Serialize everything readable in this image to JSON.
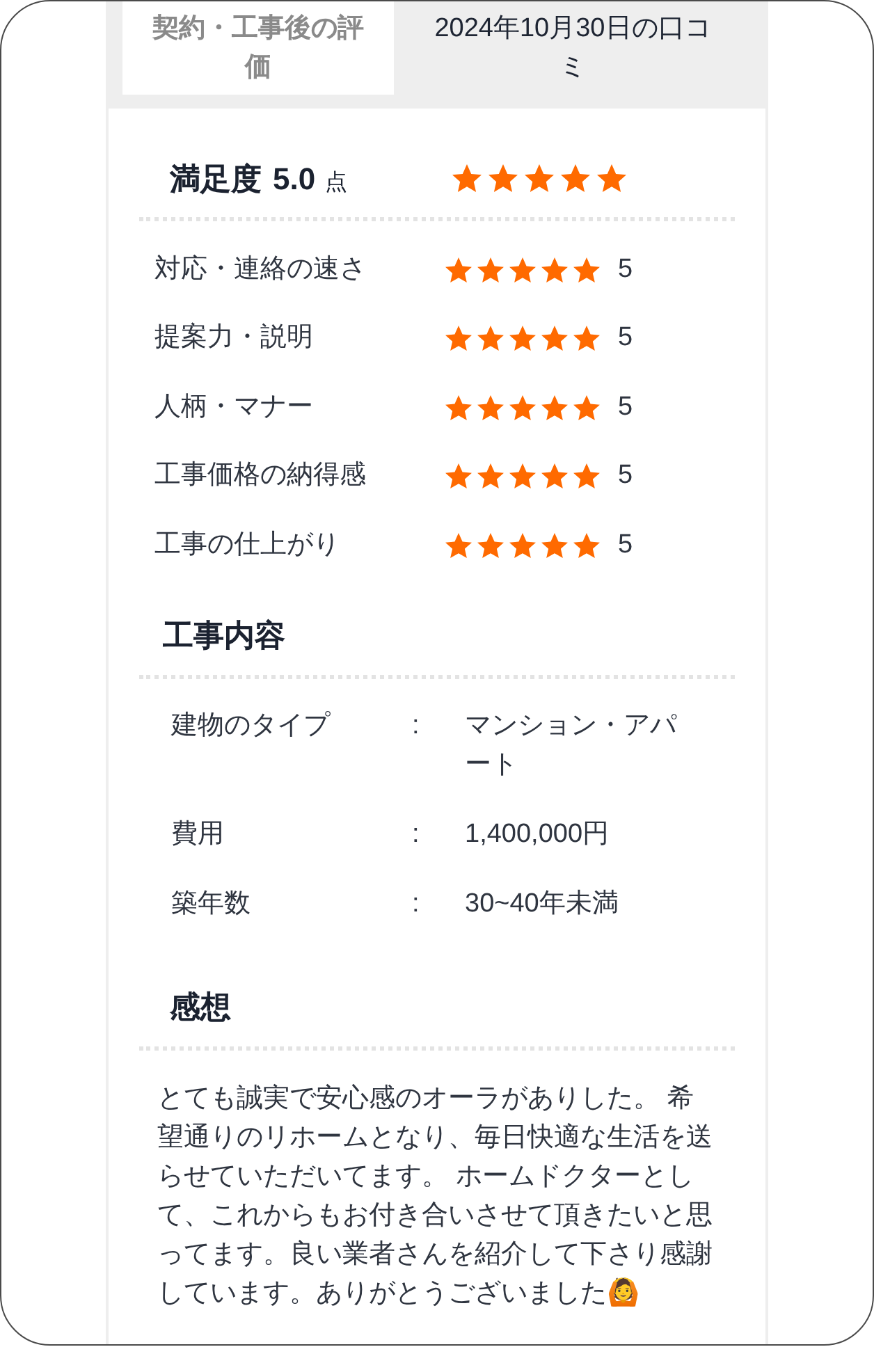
{
  "header": {
    "label": "契約・工事後の評価",
    "title": "2024年10月30日の口コミ"
  },
  "satisfaction": {
    "label": "満足度",
    "score": "5.0",
    "unit": "点",
    "stars": 5
  },
  "ratings": [
    {
      "label": "対応・連絡の速さ",
      "stars": 5,
      "score": "5"
    },
    {
      "label": "提案力・説明",
      "stars": 5,
      "score": "5"
    },
    {
      "label": "人柄・マナー",
      "stars": 5,
      "score": "5"
    },
    {
      "label": "工事価格の納得感",
      "stars": 5,
      "score": "5"
    },
    {
      "label": "工事の仕上がり",
      "stars": 5,
      "score": "5"
    }
  ],
  "work_details": {
    "title": "工事内容",
    "rows": [
      {
        "label": "建物のタイプ",
        "separator": ":",
        "value": "マンション・アパート"
      },
      {
        "label": "費用",
        "separator": ":",
        "value": "1,400,000円"
      },
      {
        "label": "築年数",
        "separator": ":",
        "value": "30~40年未満"
      }
    ]
  },
  "impressions": {
    "title": "感想",
    "text": "とても誠実で安心感のオーラがありした。 希望通りのリホームとなり、毎日快適な生活を送らせていただいてます。 ホームドクターとして、これからもお付き合いさせて頂きたいと思ってます。良い業者さんを紹介して下さり感謝しています。ありがとうございました🙆"
  }
}
